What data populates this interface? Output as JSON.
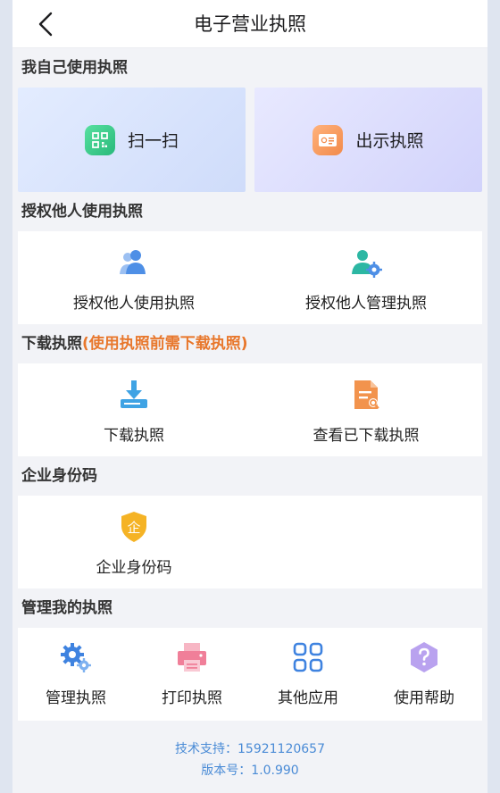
{
  "header": {
    "title": "电子营业执照"
  },
  "sections": {
    "self": {
      "title": "我自己使用执照",
      "scan_label": "扫一扫",
      "show_label": "出示执照"
    },
    "authorize": {
      "title": "授权他人使用执照",
      "items": [
        "授权他人使用执照",
        "授权他人管理执照"
      ]
    },
    "download": {
      "title": "下载执照",
      "note": "(使用执照前需下载执照)",
      "items": [
        "下载执照",
        "查看已下载执照"
      ]
    },
    "enterprise": {
      "title": "企业身份码",
      "items": [
        "企业身份码"
      ],
      "badge_char": "企"
    },
    "manage": {
      "title": "管理我的执照",
      "items": [
        "管理执照",
        "打印执照",
        "其他应用",
        "使用帮助"
      ]
    }
  },
  "footer": {
    "support": "技术支持：15921120657",
    "version": "版本号：1.0.990"
  },
  "colors": {
    "accent_blue": "#4a8bd6",
    "note_orange": "#e8772c",
    "scan_green": "#2bbf7e",
    "show_orange": "#f28a4a"
  }
}
